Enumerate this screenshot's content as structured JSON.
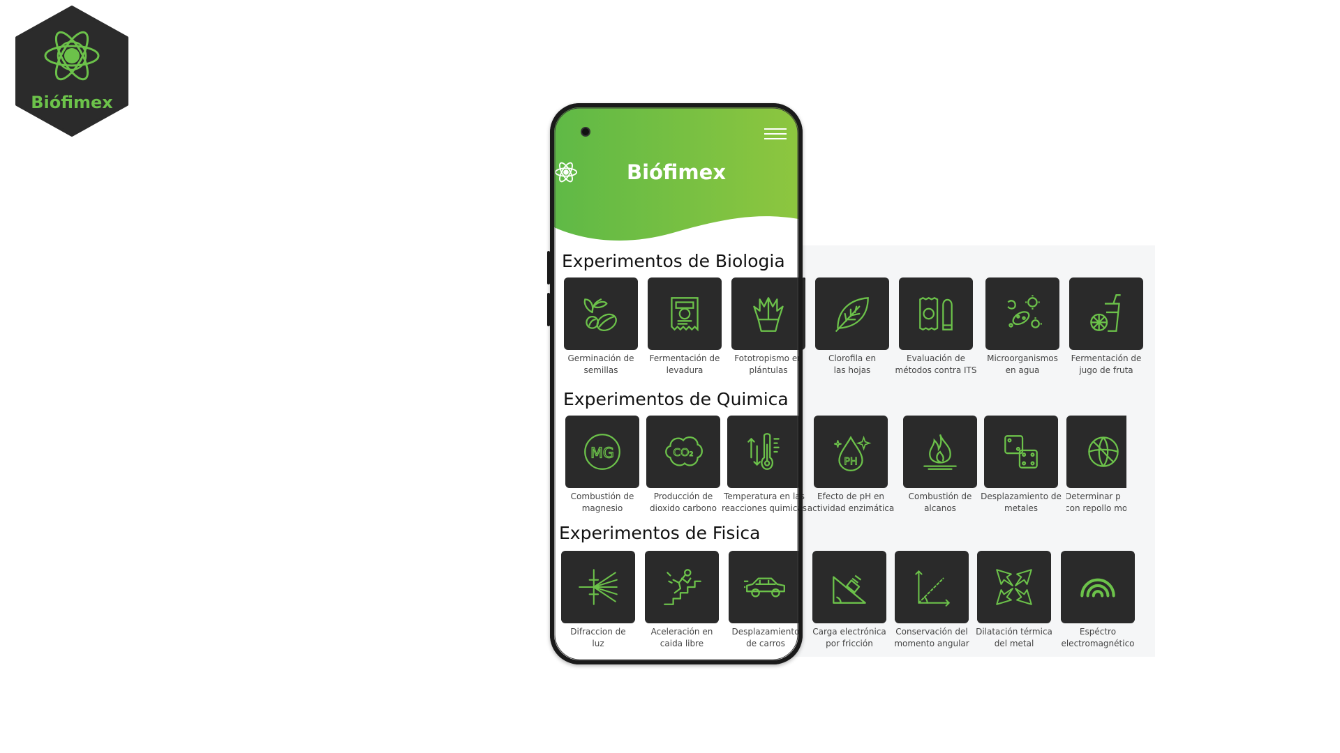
{
  "logo": {
    "label": "Biófimex",
    "accent": "#6cc24a",
    "bg": "#2b2b2b"
  },
  "app": {
    "brand": "Biófimex",
    "header_color_start": "#64bd44",
    "header_color_end": "#8cc63e",
    "menu_icon": "hamburger-icon"
  },
  "sections": [
    {
      "title": "Experimentos de Biologia",
      "items": [
        {
          "l1": "Germinación de",
          "l2": "semillas",
          "icon": "seedling-icon"
        },
        {
          "l1": "Fermentación de",
          "l2": "levadura",
          "icon": "yeast-packet-icon"
        },
        {
          "l1": "Fototropismo en",
          "l2": "plántulas",
          "icon": "potted-plant-icon"
        },
        {
          "l1": "Clorofila en",
          "l2": "las hojas",
          "icon": "leaf-icon"
        },
        {
          "l1": "Evaluación de",
          "l2": "métodos contra ITS",
          "icon": "condom-icon"
        },
        {
          "l1": "Microorganismos",
          "l2": "en agua",
          "icon": "microbes-icon"
        },
        {
          "l1": "Fermentación de",
          "l2": "jugo de fruta",
          "icon": "juice-icon"
        }
      ]
    },
    {
      "title": "Experimentos de Quimica",
      "items": [
        {
          "l1": "Combustión de",
          "l2": "magnesio",
          "icon": "mg-icon",
          "sym": "MG"
        },
        {
          "l1": "Producción de",
          "l2": "dioxido carbono",
          "icon": "co2-cloud-icon",
          "sym": "CO₂"
        },
        {
          "l1": "Temperatura en las",
          "l2": "reacciones quimicas",
          "icon": "thermometer-icon"
        },
        {
          "l1": "Efecto de pH en",
          "l2": "actividad enzimática",
          "icon": "ph-drop-icon",
          "sym": "PH"
        },
        {
          "l1": "Combustión de",
          "l2": "alcanos",
          "icon": "flame-icon"
        },
        {
          "l1": "Desplazamiento de",
          "l2": "metales",
          "icon": "metal-blocks-icon"
        },
        {
          "l1": "Determinar p",
          "l2": "con repollo mo",
          "icon": "cabbage-icon"
        }
      ]
    },
    {
      "title": "Experimentos de Fisica",
      "items": [
        {
          "l1": "Difraccion de",
          "l2": "luz",
          "icon": "light-diffraction-icon"
        },
        {
          "l1": "Aceleración en",
          "l2": "caida libre",
          "icon": "falling-person-icon"
        },
        {
          "l1": "Desplazamiento",
          "l2": "de carros",
          "icon": "car-icon"
        },
        {
          "l1": "Carga electrónica",
          "l2": "por fricción",
          "icon": "incline-friction-icon"
        },
        {
          "l1": "Conservación del",
          "l2": "momento angular",
          "icon": "angle-axes-icon"
        },
        {
          "l1": "Dilatación térmica",
          "l2": "del metal",
          "icon": "expansion-arrows-icon"
        },
        {
          "l1": "Espéctro",
          "l2": "electromagnético",
          "icon": "rainbow-icon"
        }
      ]
    }
  ]
}
